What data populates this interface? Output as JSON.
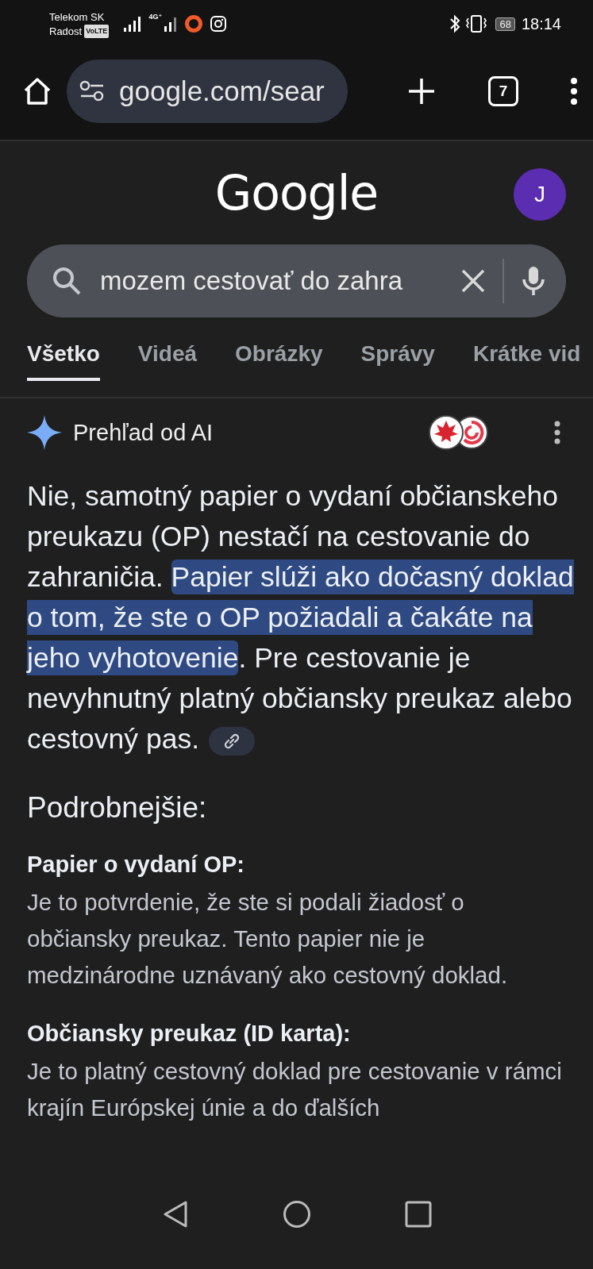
{
  "status_bar": {
    "carrier_line_1": "Telekom SK",
    "carrier_line_2": "Radost",
    "volte": "VoLTE",
    "network": "4G⁺",
    "battery": "68",
    "time": "18:14"
  },
  "browser": {
    "url": "google.com/sear",
    "tab_count": "7"
  },
  "header": {
    "logo": "Google",
    "avatar": "J"
  },
  "search": {
    "value": "mozem cestovať do zahra"
  },
  "tabs": [
    {
      "label": "Všetko",
      "selected": true
    },
    {
      "label": "Videá",
      "selected": false
    },
    {
      "label": "Obrázky",
      "selected": false
    },
    {
      "label": "Správy",
      "selected": false
    },
    {
      "label": "Krátke vid",
      "selected": false
    }
  ],
  "ai_overview": {
    "title": "Prehľad od AI",
    "answer": [
      {
        "text": "Nie, samotný papier o vydaní občianskeho preukazu (OP) nestačí na cestovanie do zahraničia. ",
        "highlighted": false
      },
      {
        "text": "Papier slúži ako dočasný doklad o tom, že ste o OP požiadali a čakáte na jeho vyhotovenie",
        "highlighted": true
      },
      {
        "text": ". Pre cestovanie je nevyhnutný platný občiansky preukaz alebo cestovný pas.",
        "highlighted": false
      }
    ],
    "details_heading": "Podrobnejšie:",
    "sections": [
      {
        "heading": "Papier o vydaní OP:",
        "body": "Je to potvrdenie, že ste si podali žiadosť o občiansky preukaz. Tento papier nie je medzinárodne uznávaný ako cestovný doklad."
      },
      {
        "heading": "Občiansky preukaz (ID karta):",
        "body": "Je to platný cestovný doklad pre cestovanie v rámci krajín Európskej únie a do ďalších"
      }
    ]
  }
}
